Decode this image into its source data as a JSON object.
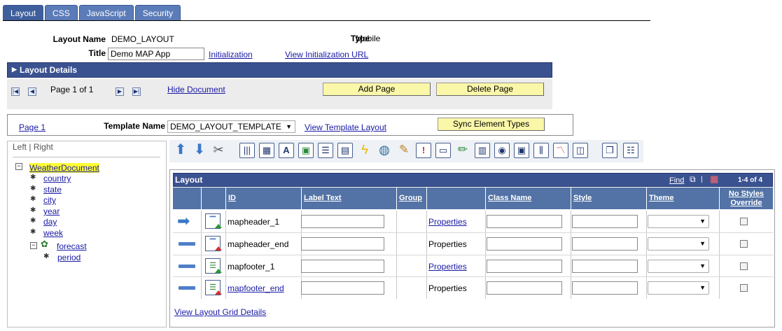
{
  "tabs": [
    "Layout",
    "CSS",
    "JavaScript",
    "Security"
  ],
  "header": {
    "layout_name_label": "Layout Name",
    "layout_name": "DEMO_LAYOUT",
    "type_label": "Type",
    "type": "Mobile",
    "title_label": "Title",
    "title_value": "Demo MAP App",
    "initialization": "Initialization",
    "view_init_url": "View Initialization URL"
  },
  "layout_details": "Layout Details",
  "pager": {
    "page_text": "Page 1 of 1",
    "hide_document": "Hide Document",
    "add_page": "Add Page",
    "delete_page": "Delete Page"
  },
  "page_bar": {
    "page_link": "Page 1",
    "template_label": "Template Name",
    "template_value": "DEMO_LAYOUT_TEMPLATE",
    "view_template": "View Template Layout",
    "sync": "Sync Element Types"
  },
  "tree": {
    "left": "Left",
    "sep": "|",
    "right": "Right",
    "root": "WeatherDocument",
    "items": [
      "country",
      "state",
      "city",
      "year",
      "day",
      "week"
    ],
    "forecast": "forecast",
    "period": "period"
  },
  "grid": {
    "title": "Layout",
    "find": "Find",
    "range": "1-4 of 4",
    "columns": [
      "ID",
      "Label Text",
      "Group",
      "",
      "Class Name",
      "Style",
      "Theme",
      "No Styles Override"
    ],
    "rows": [
      {
        "id": "mapheader_1",
        "properties": "Properties",
        "props_link": true,
        "id_link": false
      },
      {
        "id": "mapheader_end",
        "properties": "Properties",
        "props_link": false,
        "id_link": false
      },
      {
        "id": "mapfooter_1",
        "properties": "Properties",
        "props_link": true,
        "id_link": false
      },
      {
        "id": "mapfooter_end",
        "properties": "Properties",
        "props_link": false,
        "id_link": true
      }
    ],
    "footer_link": "View Layout Grid Details"
  }
}
